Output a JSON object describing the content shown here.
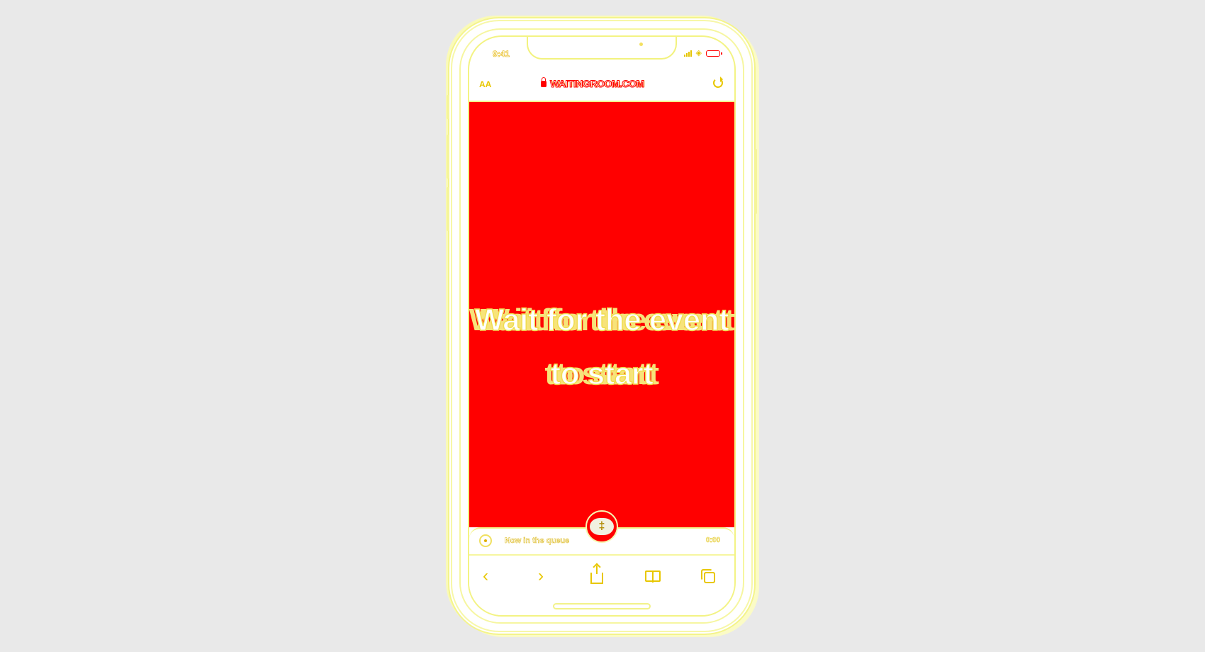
{
  "status_bar": {
    "time": "9:41"
  },
  "browser": {
    "text_size_label": "AA",
    "url": "WAITINGROOM.COM"
  },
  "content": {
    "headline": "Wait for the event to start",
    "background_color": "#ff0000"
  },
  "now_playing": {
    "title": "Now in the queue",
    "time": "0:00"
  },
  "fab": {
    "icon": "dagger-icon",
    "glyph": "‡"
  },
  "toolbar": {
    "back_icon": "chevron-left-icon",
    "forward_icon": "chevron-right-icon",
    "share_icon": "share-icon",
    "bookmarks_icon": "book-icon",
    "tabs_icon": "tabs-icon"
  },
  "colors": {
    "page_background": "#e9e9e9",
    "accent_red": "#ff0000",
    "outline_yellow": "#e8c700"
  }
}
